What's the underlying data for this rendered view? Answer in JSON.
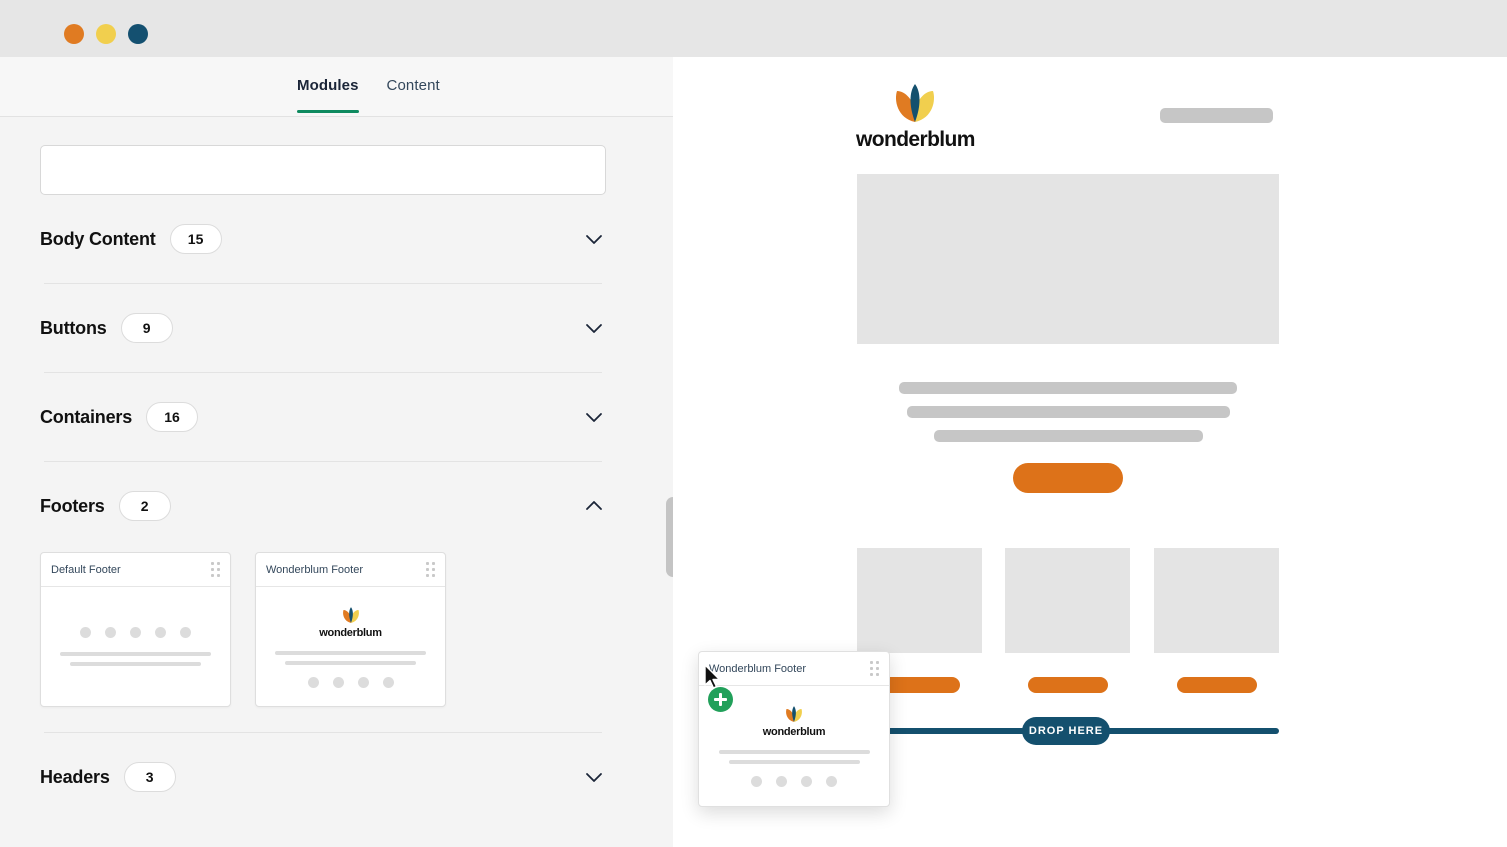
{
  "window": {
    "dots": [
      {
        "name": "close-dot",
        "color": "#e07b22"
      },
      {
        "name": "minimize-dot",
        "color": "#f1cf4e"
      },
      {
        "name": "maximize-dot",
        "color": "#145070"
      }
    ]
  },
  "sidebar": {
    "tabs": [
      {
        "label": "Modules",
        "active": true
      },
      {
        "label": "Content",
        "active": false
      }
    ],
    "search": {
      "value": "",
      "placeholder": ""
    },
    "categories": [
      {
        "name": "Body Content",
        "count": "15",
        "expanded": false,
        "chevron": "chevron-down-icon"
      },
      {
        "name": "Buttons",
        "count": "9",
        "expanded": false,
        "chevron": "chevron-down-icon"
      },
      {
        "name": "Containers",
        "count": "16",
        "expanded": false,
        "chevron": "chevron-down-icon"
      },
      {
        "name": "Footers",
        "count": "2",
        "expanded": true,
        "chevron": "chevron-up-icon"
      },
      {
        "name": "Headers",
        "count": "3",
        "expanded": false,
        "chevron": "chevron-down-icon"
      }
    ],
    "footer_cards": [
      {
        "title": "Default Footer",
        "kind": "default"
      },
      {
        "title": "Wonderblum Footer",
        "kind": "wonderblum"
      }
    ],
    "drag_handle_icon": "drag-handle-icon"
  },
  "canvas": {
    "brand": {
      "wordmark": "wonderblum",
      "logo_icon": "tulip-logo-icon",
      "colors": {
        "petal_left": "#e07b22",
        "petal_right": "#f1cf4e",
        "petal_center": "#14506e"
      }
    },
    "accent_color": "#dd7219",
    "drop_indicator": {
      "label": "DROP HERE",
      "color": "#14506e"
    }
  },
  "drag_ghost": {
    "title": "Wonderblum Footer",
    "wordmark": "wonderblum",
    "cursor_icon": "cursor-arrow-icon",
    "badge_icon": "plus-badge-icon",
    "badge_color": "#21a05a"
  }
}
